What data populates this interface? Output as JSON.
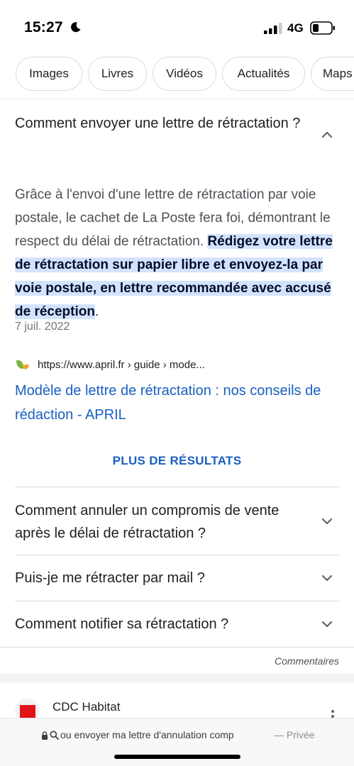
{
  "status": {
    "time": "15:27",
    "network": "4G"
  },
  "chips": [
    {
      "label": "Images"
    },
    {
      "label": "Livres"
    },
    {
      "label": "Vidéos"
    },
    {
      "label": "Actualités"
    },
    {
      "label": "Maps"
    }
  ],
  "expanded_question": {
    "title": "Comment envoyer une lettre de rétractation ?",
    "answer_plain": "Grâce à l'envoi d'une lettre de rétractation par voie postale, le cachet de La Poste fera foi, démontrant le respect du délai de rétractation. ",
    "answer_highlight": "Rédigez votre lettre de rétractation sur papier libre et envoyez-la par voie postale, en lettre recommandée avec accusé de réception",
    "answer_end": ".",
    "date": "7 juil. 2022",
    "source_url": "https://www.april.fr › guide › mode...",
    "result_title": "Modèle de lettre de rétractation : nos conseils de rédaction - APRIL"
  },
  "more_results_label": "PLUS DE RÉSULTATS",
  "questions": [
    {
      "title": "Comment annuler un compromis de vente après le délai de rétractation ?"
    },
    {
      "title": "Puis-je me rétracter par mail ?"
    },
    {
      "title": "Comment notifier sa rétractation ?"
    }
  ],
  "comments_label": "Commentaires",
  "next_result": {
    "name": "CDC Habitat"
  },
  "address_bar": {
    "query": "ou envoyer ma lettre d'annulation comp",
    "mode": "— Privée"
  },
  "icons": [
    "moon-icon",
    "signal-icon",
    "battery-icon",
    "chevron-up-icon",
    "chevron-down-icon",
    "april-favicon",
    "more-vert-icon",
    "lock-icon",
    "search-icon"
  ]
}
